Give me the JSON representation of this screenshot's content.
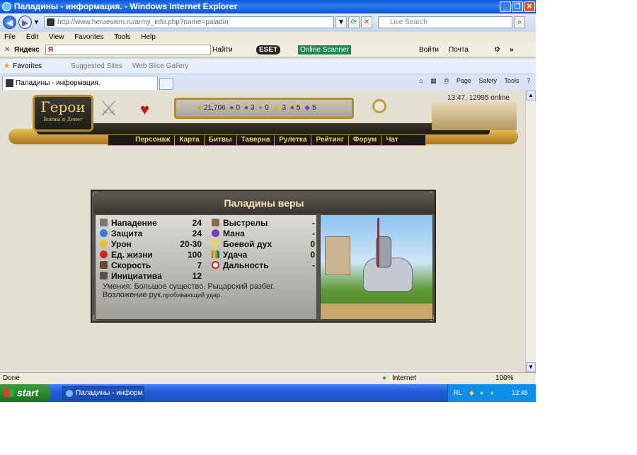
{
  "window": {
    "title": "Паладины - информация. - Windows Internet Explorer"
  },
  "address": {
    "url": "http://www.heroeswm.ru/army_info.php?name=paladin",
    "search_placeholder": "Live Search"
  },
  "menu": [
    "File",
    "Edit",
    "View",
    "Favorites",
    "Tools",
    "Help"
  ],
  "yandex_toolbar": {
    "brand": "Яндекс",
    "find": "Найти",
    "eset": "ESET",
    "scanner": "Online Scanner",
    "login": "Войти",
    "mail": "Почта"
  },
  "favbar": {
    "favorites": "Favorites",
    "suggested": "Suggested Sites",
    "gallery": "Web Slice Gallery"
  },
  "tab": {
    "title": "Паладины - информация."
  },
  "command_bar": {
    "page": "Page",
    "safety": "Safety",
    "tools": "Tools"
  },
  "game": {
    "logo_title": "Герои",
    "logo_subtitle": "Войны и Денег",
    "clock": "13:47, 12995 online",
    "resources": [
      "21,706",
      "0",
      "3",
      "0",
      "3",
      "5",
      "5"
    ],
    "nav": [
      "Персонаж",
      "Карта",
      "Битвы",
      "Таверна",
      "Рулетка",
      "Рейтинг",
      "Форум",
      "Чат"
    ]
  },
  "unit": {
    "name": "Паладины веры",
    "left_stats": [
      {
        "label": "Нападение",
        "value": "24"
      },
      {
        "label": "Защита",
        "value": "24"
      },
      {
        "label": "Урон",
        "value": "20-30"
      },
      {
        "label": "Ед. жизни",
        "value": "100"
      },
      {
        "label": "Скорость",
        "value": "7"
      },
      {
        "label": "Инициатива",
        "value": "12"
      }
    ],
    "right_stats": [
      {
        "label": "Выстрелы",
        "value": "-"
      },
      {
        "label": "Мана",
        "value": "-"
      },
      {
        "label": "Боевой дух",
        "value": "0"
      },
      {
        "label": "Удача",
        "value": "0"
      },
      {
        "label": "Дальность",
        "value": "-"
      }
    ],
    "skills_line1": "Умения: Большое существо. Рыцарский разбег.",
    "skills_line2": "Возложение рук.",
    "skills_small": "пробивающий удар."
  },
  "status": {
    "left": "Done",
    "zone": "Internet",
    "zoom": "100%"
  },
  "taskbar": {
    "start": "start",
    "task": "Паладины - информ...",
    "lang": "RL",
    "time": "13:48"
  }
}
